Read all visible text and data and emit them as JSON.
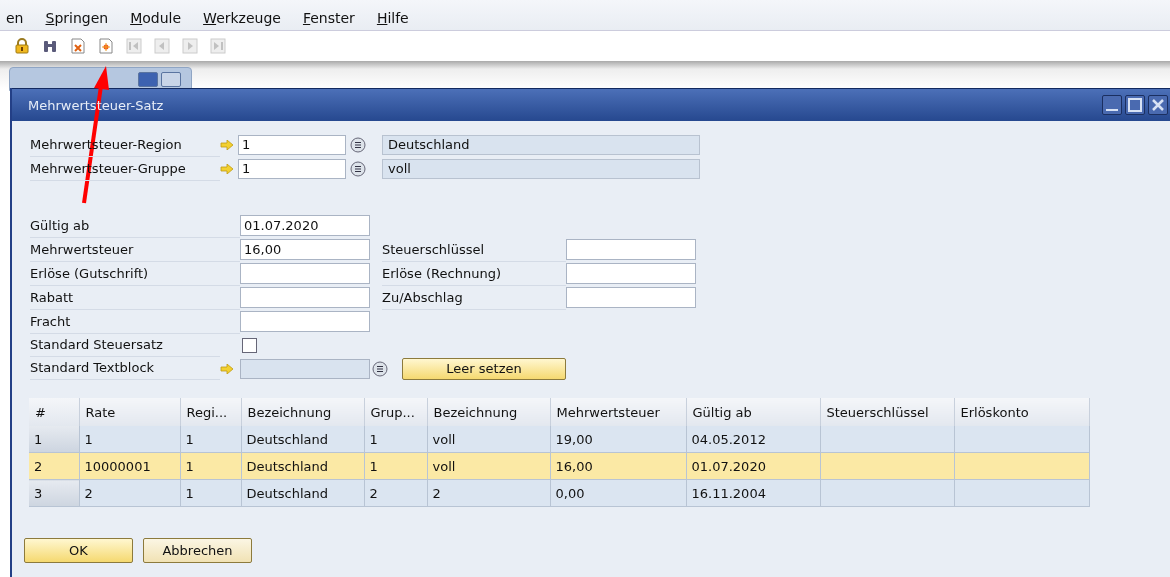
{
  "menu": [
    {
      "label": "en"
    },
    {
      "label": "Springen"
    },
    {
      "label": "Module"
    },
    {
      "label": "Werkzeuge"
    },
    {
      "label": "Fenster"
    },
    {
      "label": "Hilfe"
    }
  ],
  "toolbar": [
    {
      "kind": "lock",
      "disabled": false
    },
    {
      "kind": "binoculars",
      "disabled": false
    },
    {
      "kind": "doc-cross",
      "disabled": false
    },
    {
      "kind": "doc-star",
      "disabled": false
    },
    {
      "kind": "first",
      "disabled": true
    },
    {
      "kind": "prev",
      "disabled": true
    },
    {
      "kind": "next",
      "disabled": true
    },
    {
      "kind": "last",
      "disabled": true
    }
  ],
  "window": {
    "title": "Mehrwertsteuer-Satz"
  },
  "lookups": [
    {
      "label": "Mehrwertsteuer-Region",
      "value": "1",
      "description": "Deutschland"
    },
    {
      "label": "Mehrwertsteuer-Gruppe",
      "value": "1",
      "description": "voll"
    }
  ],
  "fields_left": [
    {
      "label": "Gültig ab",
      "value": "01.07.2020"
    },
    {
      "label": "Mehrwertsteuer",
      "value": "16,00"
    },
    {
      "label": "Erlöse (Gutschrift)"
    },
    {
      "label": "Rabatt"
    },
    {
      "label": "Fracht"
    }
  ],
  "fields_right": [
    {
      "label": "Steuerschlüssel"
    },
    {
      "label": "Erlöse (Rechnung)"
    },
    {
      "label": "Zu/Abschlag"
    }
  ],
  "standard_rate": {
    "label": "Standard Steuersatz",
    "checked": false
  },
  "text_block": {
    "label": "Standard Textblock",
    "button": "Leer setzen"
  },
  "table": {
    "columns": [
      "#",
      "Rate",
      "Regi...",
      "Bezeichnung",
      "Grup...",
      "Bezeichnung",
      "Mehrwertsteuer",
      "Gültig ab",
      "Steuerschlüssel",
      "Erlöskonto"
    ],
    "rows": [
      {
        "selected": false,
        "cells": [
          "1",
          "1",
          "1",
          "Deutschland",
          "1",
          "voll",
          "19,00",
          "04.05.2012",
          "",
          ""
        ]
      },
      {
        "selected": true,
        "cells": [
          "2",
          "10000001",
          "1",
          "Deutschland",
          "1",
          "voll",
          "16,00",
          "01.07.2020",
          "",
          ""
        ]
      },
      {
        "selected": false,
        "cells": [
          "3",
          "2",
          "1",
          "Deutschland",
          "2",
          "2",
          "0,00",
          "16.11.2004",
          "",
          ""
        ]
      }
    ]
  },
  "buttons": [
    {
      "label": "OK",
      "kind": "primary"
    },
    {
      "label": "Abbrechen",
      "kind": "normal"
    }
  ]
}
